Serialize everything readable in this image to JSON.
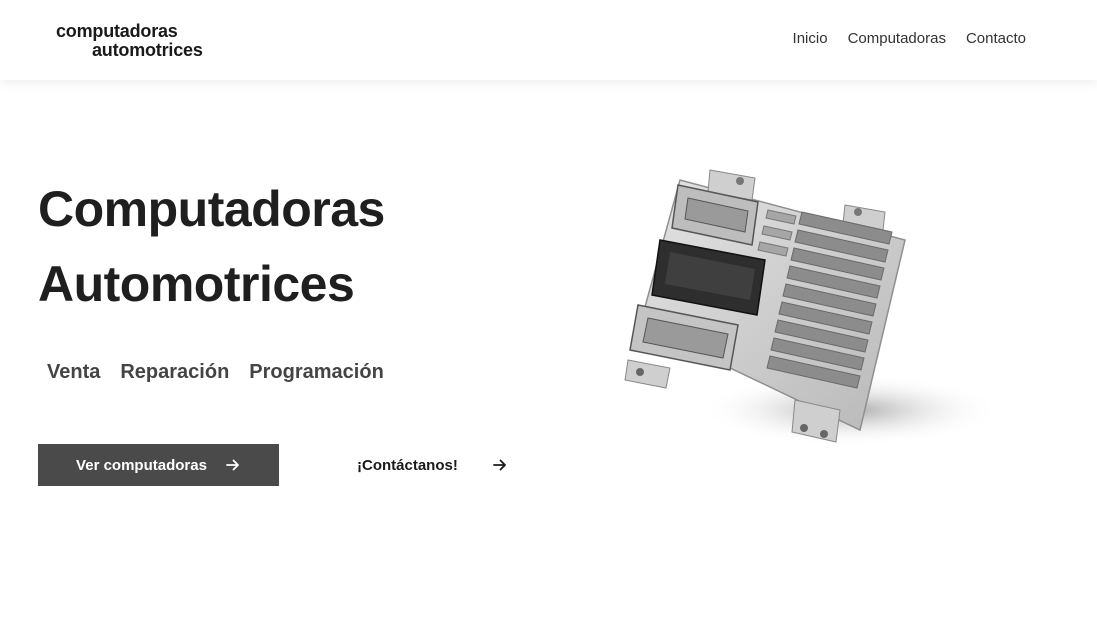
{
  "header": {
    "logo_line1": "computadoras",
    "logo_line2": "automotrices",
    "nav": [
      {
        "label": "Inicio"
      },
      {
        "label": "Computadoras"
      },
      {
        "label": "Contacto"
      }
    ]
  },
  "hero": {
    "title_line1": "Computadoras",
    "title_line2": "Automotrices",
    "services": [
      "Venta",
      "Reparación",
      "Programación"
    ],
    "primary_button": {
      "label": "Ver computadoras",
      "icon": "arrow-right-icon"
    },
    "secondary_link": {
      "label": "¡Contáctanos!",
      "icon": "arrow-right-icon"
    },
    "image": {
      "subject": "automotive ECU computer module"
    }
  }
}
